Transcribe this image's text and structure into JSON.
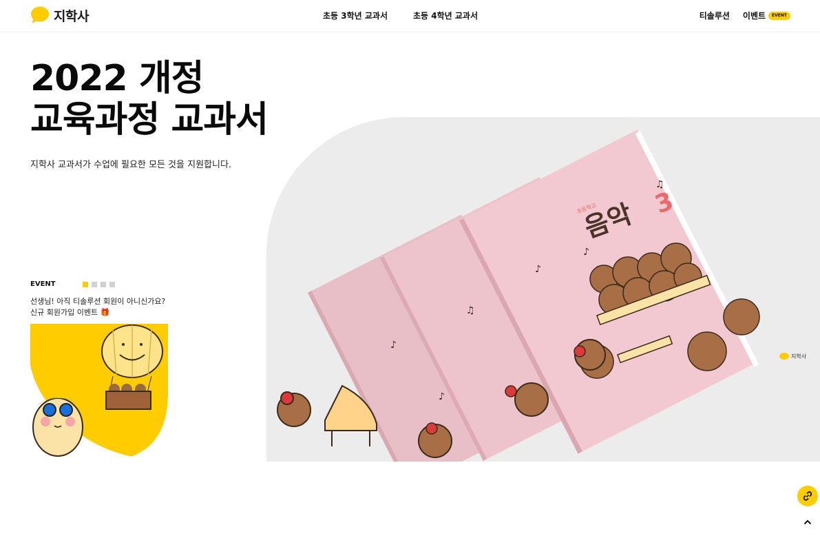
{
  "header": {
    "logo_text": "지학사",
    "nav": [
      "초등 3학년 교과서",
      "초등 4학년 교과서"
    ],
    "util": {
      "tsolution": "티솔루션",
      "event": "이벤트",
      "event_badge": "EVENT"
    }
  },
  "hero": {
    "title_line1": "2022 개정",
    "title_line2": "교육과정 교과서",
    "description": "지학사 교과서가 수업에 필요한 모든 것을 지원합니다.",
    "book": {
      "subject": "음악",
      "grade": "3",
      "school": "초등학교",
      "publisher": "지학사"
    }
  },
  "event": {
    "label": "EVENT",
    "slides": {
      "total": 4,
      "active": 1
    },
    "text_line1": "선생님! 아직 티솔루션 회원이 아니신가요?",
    "text_line2": "신규 회원가입 이벤트 🎁"
  },
  "colors": {
    "accent": "#ffcc00",
    "book_pink": "#f2c9d0",
    "title_red": "#e86a6a"
  },
  "icons": {
    "float": "link-icon",
    "top": "chevron-up-icon"
  }
}
